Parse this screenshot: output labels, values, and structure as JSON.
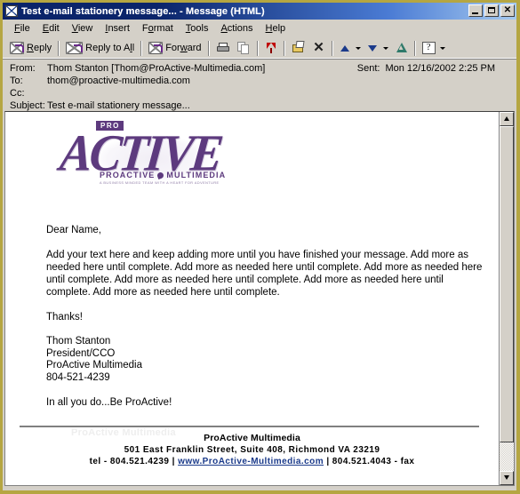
{
  "window": {
    "title": "Test e-mail stationery message... - Message (HTML)",
    "icon": "envelope-icon",
    "minimize_label": "_",
    "maximize_label": "",
    "close_label": "✕"
  },
  "menubar": {
    "items": [
      {
        "label": "File",
        "accel": "F"
      },
      {
        "label": "Edit",
        "accel": "E"
      },
      {
        "label": "View",
        "accel": "V"
      },
      {
        "label": "Insert",
        "accel": "I"
      },
      {
        "label": "Format",
        "accel": "o"
      },
      {
        "label": "Tools",
        "accel": "T"
      },
      {
        "label": "Actions",
        "accel": "A"
      },
      {
        "label": "Help",
        "accel": "H"
      }
    ]
  },
  "toolbar": {
    "reply_label": "Reply",
    "reply_all_label": "Reply to All",
    "forward_label": "Forward",
    "print_icon": "printer-icon",
    "copy_icon": "copy-pages-icon",
    "flag_icon": "flag-icon",
    "move_folder_icon": "move-to-folder-icon",
    "delete_icon": "delete-x-icon",
    "previous_icon": "previous-item-up-arrow-icon",
    "next_icon": "next-item-down-arrow-icon",
    "address_book_icon": "address-book-tree-icon",
    "help_icon": "help-question-icon"
  },
  "header": {
    "from_label": "From:",
    "from_value": "Thom Stanton [Thom@ProActive-Multimedia.com]",
    "to_label": "To:",
    "to_value": "thom@proactive-multimedia.com",
    "cc_label": "Cc:",
    "cc_value": "",
    "subject_label": "Subject:",
    "subject_value": "Test e-mail stationery message...",
    "sent_label": "Sent:",
    "sent_value": "Mon 12/16/2002 2:25 PM"
  },
  "message": {
    "logo": {
      "badge": "PRO",
      "wordmark": "ACTIVE",
      "tagline_left": "PROACTIVE",
      "tagline_right": "MULTIMEDIA",
      "subtagline": "A BUSINESS MINDED TEAM WITH A HEART FOR ADVENTURE"
    },
    "greeting": "Dear Name,",
    "paragraph": "Add your text here and keep adding more until you have finished your message. Add more as needed here until complete. Add more as needed here until complete. Add more as needed here until complete. Add more as needed here until complete. Add more as needed here until complete. Add more as needed here until complete.",
    "closing": "Thanks!",
    "signature": {
      "name": "Thom Stanton",
      "title": "President/CCO",
      "company": "ProActive Multimedia",
      "phone": "804-521-4239"
    },
    "tagline": "In all you do...Be ProActive!",
    "footer": {
      "watermark": "ProActive Multimedia",
      "company": "ProActive Multimedia",
      "address": "501 East Franklin Street, Suite 408, Richmond VA 23219",
      "tel_prefix": "tel - 804.521.4239",
      "separator": "|",
      "website": "www.ProActive-Multimedia.com",
      "fax": "804.521.4043 - fax"
    }
  },
  "colors": {
    "window_border": "#b5a642",
    "titlebar_start": "#0a246a",
    "titlebar_end": "#a6caf0",
    "chrome": "#d4d0c8",
    "brand_purple": "#5d3a7e",
    "link_blue": "#1a3a8a",
    "flag_red": "#c00000"
  }
}
